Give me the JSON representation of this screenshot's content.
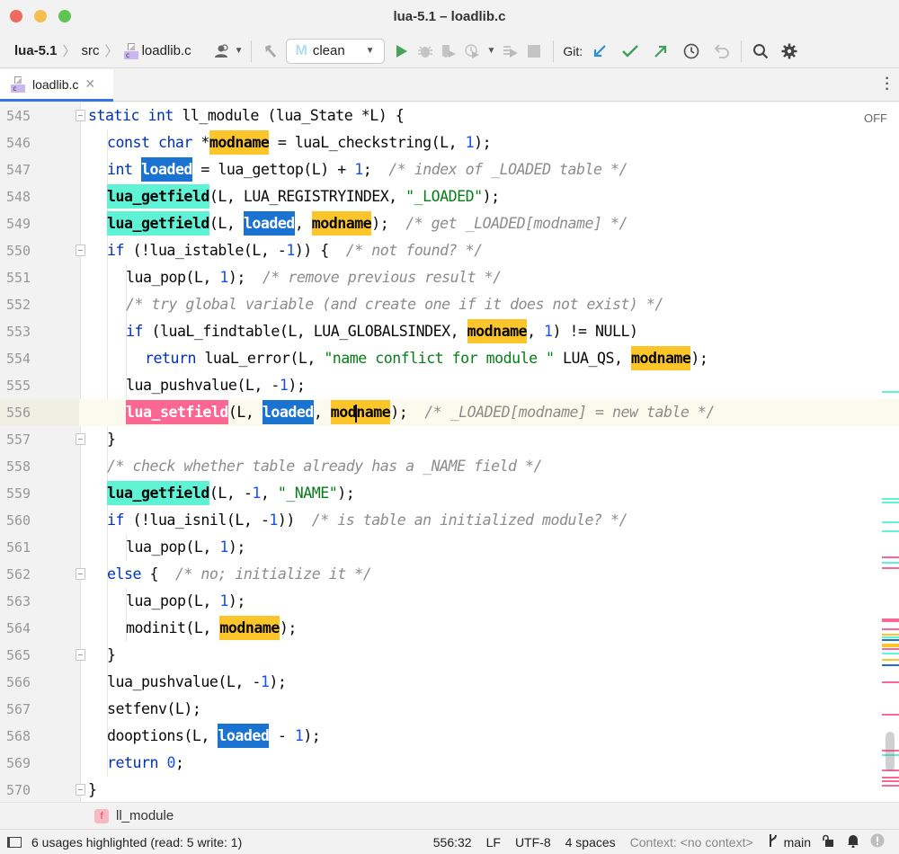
{
  "window": {
    "title": "lua-5.1 – loadlib.c"
  },
  "toolbar": {
    "breadcrumb": [
      "lua-5.1",
      "src",
      "loadlib.c"
    ],
    "run_config": "clean",
    "git_label": "Git:"
  },
  "tabs": [
    {
      "label": "loadlib.c",
      "active": true
    }
  ],
  "editor": {
    "off_label": "OFF",
    "current_line": 556,
    "lines": [
      {
        "n": "545"
      },
      {
        "n": "546"
      },
      {
        "n": "547"
      },
      {
        "n": "548"
      },
      {
        "n": "549"
      },
      {
        "n": "550"
      },
      {
        "n": "551"
      },
      {
        "n": "552"
      },
      {
        "n": "553"
      },
      {
        "n": "554"
      },
      {
        "n": "555"
      },
      {
        "n": "556"
      },
      {
        "n": "557"
      },
      {
        "n": "558"
      },
      {
        "n": "559"
      },
      {
        "n": "560"
      },
      {
        "n": "561"
      },
      {
        "n": "562"
      },
      {
        "n": "563"
      },
      {
        "n": "564"
      },
      {
        "n": "565"
      },
      {
        "n": "566"
      },
      {
        "n": "567"
      },
      {
        "n": "568"
      },
      {
        "n": "569"
      },
      {
        "n": "570"
      }
    ],
    "tokens": {
      "static": "static",
      "int": "int",
      "const": "const",
      "char": "char",
      "if": "if",
      "else": "else",
      "return": "return",
      "modname": "modname",
      "loaded": "loaded",
      "lua_getfield": "lua_getfield",
      "lua_setfield": "lua_setfield",
      "l545": "ll_module (lua_State *L) {",
      "l546a": " *",
      "l546b": " = luaL_checkstring(L, ",
      "l546c": "1",
      "l546d": ");",
      "l547a": " = lua_gettop(L) + ",
      "l547b": "1",
      "l547c": ";  ",
      "l547cm": "/* index of _LOADED table */",
      "l548a": "(L, LUA_REGISTRYINDEX, ",
      "l548s": "\"_LOADED\"",
      "l548b": ");",
      "l549a": "(L, ",
      "l549b": ", ",
      "l549c": ");  ",
      "l549cm": "/* get _LOADED[modname] */",
      "l550a": " (!lua_istable(L, -",
      "l550b": "1",
      "l550c": ")) {  ",
      "l550cm": "/* not found? */",
      "l551a": "lua_pop(L, ",
      "l551b": "1",
      "l551c": ");  ",
      "l551cm": "/* remove previous result */",
      "l552cm": "/* try global variable (and create one if it does not exist) */",
      "l553a": " (luaL_findtable(L, LUA_GLOBALSINDEX, ",
      "l553b": ", ",
      "l553c": "1",
      "l553d": ") != NULL)",
      "l554a": " luaL_error(L, ",
      "l554s": "\"name conflict for module \"",
      "l554b": " LUA_QS, ",
      "l554c": ");",
      "l555a": "lua_pushvalue(L, -",
      "l555b": "1",
      "l555c": ");",
      "l556a": "(L, ",
      "l556b": ", ",
      "l556m1": "mod",
      "l556m2": "name",
      "l556c": ");  ",
      "l556cm": "/* _LOADED[modname] = new table */",
      "l557": "}",
      "l558cm": "/* check whether table already has a _NAME field */",
      "l559a": "(L, -",
      "l559b": "1",
      "l559c": ", ",
      "l559s": "\"_NAME\"",
      "l559d": ");",
      "l560a": " (!lua_isnil(L, -",
      "l560b": "1",
      "l560c": "))  ",
      "l560cm": "/* is table an initialized module? */",
      "l561a": "lua_pop(L, ",
      "l561b": "1",
      "l561c": ");",
      "l562a": " {  ",
      "l562cm": "/* no; initialize it */",
      "l563a": "lua_pop(L, ",
      "l563b": "1",
      "l563c": ");",
      "l564a": "modinit(L, ",
      "l564b": ");",
      "l565": "}",
      "l566a": "lua_pushvalue(L, -",
      "l566b": "1",
      "l566c": ");",
      "l567": "setfenv(L);",
      "l568a": "dooptions(L, ",
      "l568b": " - ",
      "l568c": "1",
      "l568d": ");",
      "l569a": " ",
      "l569b": "0",
      "l569c": ";",
      "l570": "}"
    }
  },
  "bottom_breadcrumb": {
    "badge": "f",
    "label": "ll_module"
  },
  "statusbar": {
    "message": "6 usages highlighted (read: 5 write: 1)",
    "position": "556:32",
    "line_ending": "LF",
    "encoding": "UTF-8",
    "indent": "4 spaces",
    "context": "Context: <no context>",
    "branch": "main"
  },
  "colors": {
    "read_highlight": "#fcc52a",
    "write_highlight": "#1a73d0",
    "getfield_highlight": "#5ff3d6",
    "setfield_highlight": "#fb6694",
    "keyword": "#0033b3",
    "number": "#1750eb",
    "string": "#067d17",
    "comment": "#8c8c8c"
  }
}
